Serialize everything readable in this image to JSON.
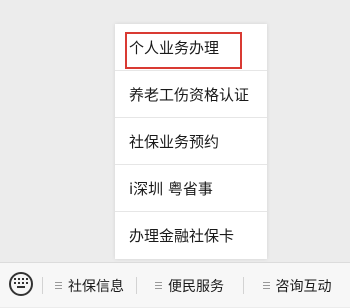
{
  "popup_menu": {
    "items": [
      {
        "label": "个人业务办理"
      },
      {
        "label": "养老工伤资格认证"
      },
      {
        "label": "社保业务预约"
      },
      {
        "label": "i深圳 粤省事"
      },
      {
        "label": "办理金融社保卡"
      }
    ],
    "highlighted_index": 0,
    "highlight_color": "#d93a33"
  },
  "bottom_bar": {
    "keyboard_icon": "keyboard-icon",
    "menu_icon": "menu-lines-icon",
    "tabs": [
      {
        "label": "社保信息"
      },
      {
        "label": "便民服务"
      },
      {
        "label": "咨询互动"
      }
    ]
  }
}
